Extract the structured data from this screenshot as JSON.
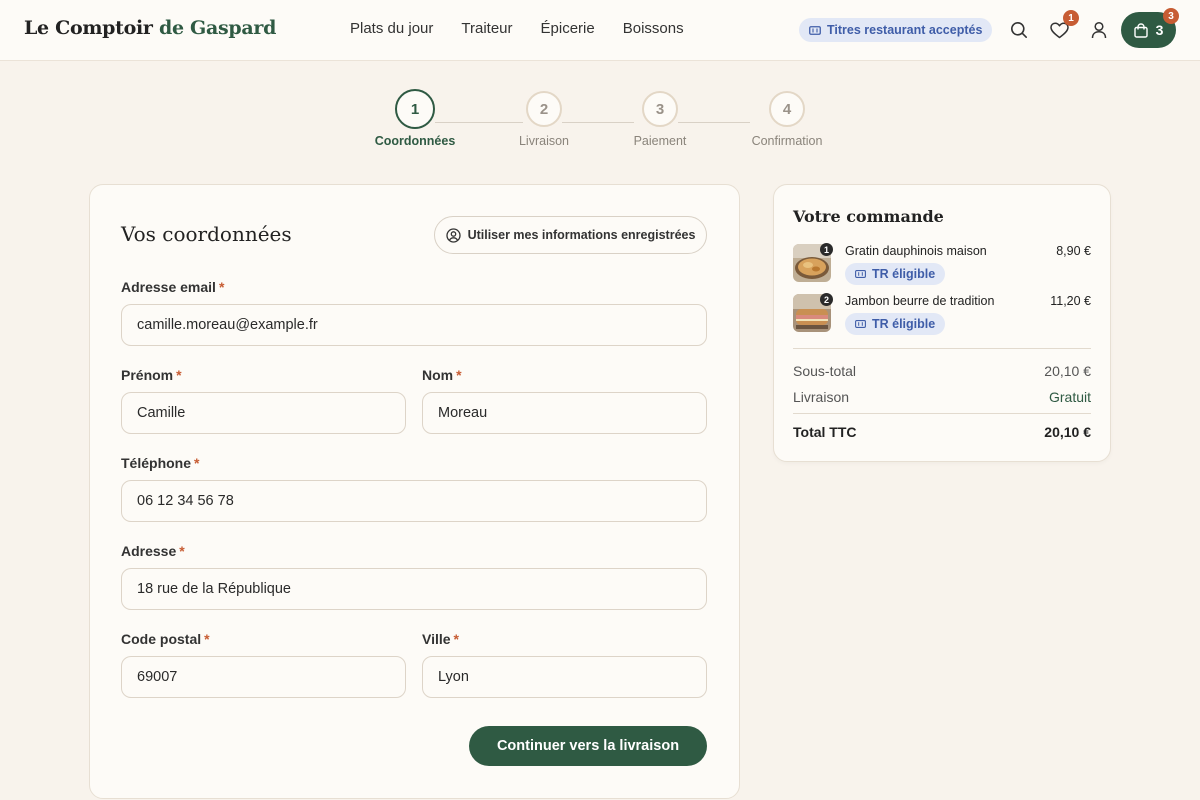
{
  "header": {
    "logo_part1": "Le Comptoir",
    "logo_part2": "de Gaspard",
    "nav": [
      "Plats du jour",
      "Traiteur",
      "Épicerie",
      "Boissons"
    ],
    "tr_pill": "Titres restaurant acceptés",
    "wishlist_count": "1",
    "cart_count": "3",
    "cart_badge": "3",
    "brand_color": "#2f5a43",
    "accent_color": "#c75c33"
  },
  "stepper": [
    {
      "num": "1",
      "label": "Coordonnées"
    },
    {
      "num": "2",
      "label": "Livraison"
    },
    {
      "num": "3",
      "label": "Paiement"
    },
    {
      "num": "4",
      "label": "Confirmation"
    }
  ],
  "form": {
    "title": "Vos coordonnées",
    "saved_button": "Utiliser mes informations enregistrées",
    "required_mark": "*",
    "email_label": "Adresse email",
    "email_value": "camille.moreau@example.fr",
    "firstname_label": "Prénom",
    "firstname_value": "Camille",
    "lastname_label": "Nom",
    "lastname_value": "Moreau",
    "phone_label": "Téléphone",
    "phone_value": "06 12 34 56 78",
    "address_label": "Adresse",
    "address_value": "18 rue de la République",
    "zip_label": "Code postal",
    "zip_value": "69007",
    "city_label": "Ville",
    "city_value": "Lyon",
    "continue_button": "Continuer vers la livraison"
  },
  "summary": {
    "title": "Votre commande",
    "items": [
      {
        "name": "Gratin dauphinois maison",
        "qty": "1",
        "price": "8,90 €",
        "badge": "TR éligible"
      },
      {
        "name": "Jambon beurre de tradition",
        "qty": "2",
        "price": "11,20 €",
        "badge": "TR éligible"
      }
    ],
    "subtotal_label": "Sous-total",
    "subtotal_value": "20,10 €",
    "delivery_label": "Livraison",
    "delivery_value": "Gratuit",
    "total_label": "Total TTC",
    "total_value": "20,10 €"
  }
}
